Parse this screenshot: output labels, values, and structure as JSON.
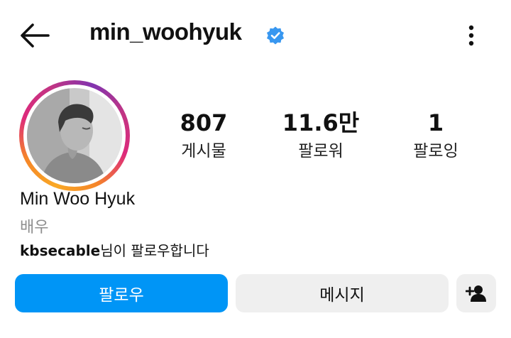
{
  "header": {
    "back_icon": "arrow-left-icon",
    "username": "min_woohyuk",
    "verified_icon": "verified-badge-icon",
    "verified_color": "#3897f0",
    "more_icon": "more-vertical-icon"
  },
  "profile": {
    "avatar_icon": "profile-photo",
    "name": "Min Woo Hyuk",
    "category": "배우",
    "followed_by_user": "kbsecable",
    "followed_by_suffix": "님이 팔로우합니다"
  },
  "stats": [
    {
      "value": "807",
      "label": "게시물"
    },
    {
      "value": "11.6만",
      "label": "팔로워"
    },
    {
      "value": "1",
      "label": "팔로잉"
    }
  ],
  "actions": {
    "follow_label": "팔로우",
    "message_label": "메시지",
    "suggest_icon": "add-person-icon",
    "follow_color": "#0095f6",
    "secondary_color": "#efefef"
  }
}
